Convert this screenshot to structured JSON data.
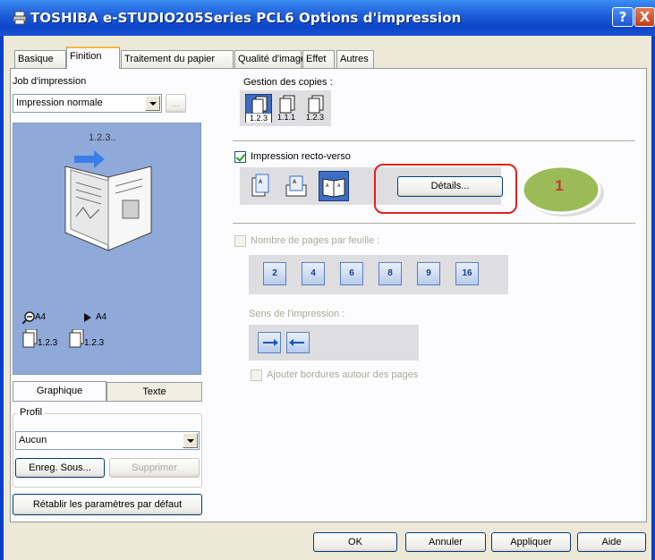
{
  "window": {
    "title": "TOSHIBA e-STUDIO205Series PCL6 Options d'impression",
    "help": "?",
    "close": "X"
  },
  "tabs": [
    {
      "label": "Basique"
    },
    {
      "label": "Finition",
      "active": true
    },
    {
      "label": "Traitement du papier"
    },
    {
      "label": "Qualité d'image"
    },
    {
      "label": "Effet"
    },
    {
      "label": "Autres"
    }
  ],
  "left": {
    "job_label": "Job d'impression",
    "job_value": "Impression normale",
    "job_more": "...",
    "preview_caption": "1.2.3..",
    "zoom_paper": "A4",
    "output_paper": "A4",
    "copy_order_1": "1.2.3",
    "copy_order_2": "1.2.3",
    "view_tabs": [
      "Graphique",
      "Texte"
    ],
    "profile_label": "Profil",
    "profile_value": "Aucun",
    "save_as": "Enreg. Sous...",
    "delete": "Supprimer",
    "restore": "Rétablir les paramètres par défaut"
  },
  "right": {
    "copies_label": "Gestion des copies :",
    "copies_options": [
      "1.2.3",
      "1.1.1",
      "1.2.3"
    ],
    "duplex_label": "Impression recto-verso",
    "details": "Détails...",
    "nup_label": "Nombre de pages par feuille :",
    "nup_options": [
      "2",
      "4",
      "6",
      "8",
      "9",
      "16"
    ],
    "direction_label": "Sens de l'impression :",
    "borders_label": "Ajouter bordures autour des pages"
  },
  "annotation": {
    "number": "1",
    "callout_color": "#e0211e",
    "badge_color": "#9bbb59",
    "number_color": "#c0392b"
  },
  "footer": {
    "ok": "OK",
    "cancel": "Annuler",
    "apply": "Appliquer",
    "help": "Aide"
  }
}
